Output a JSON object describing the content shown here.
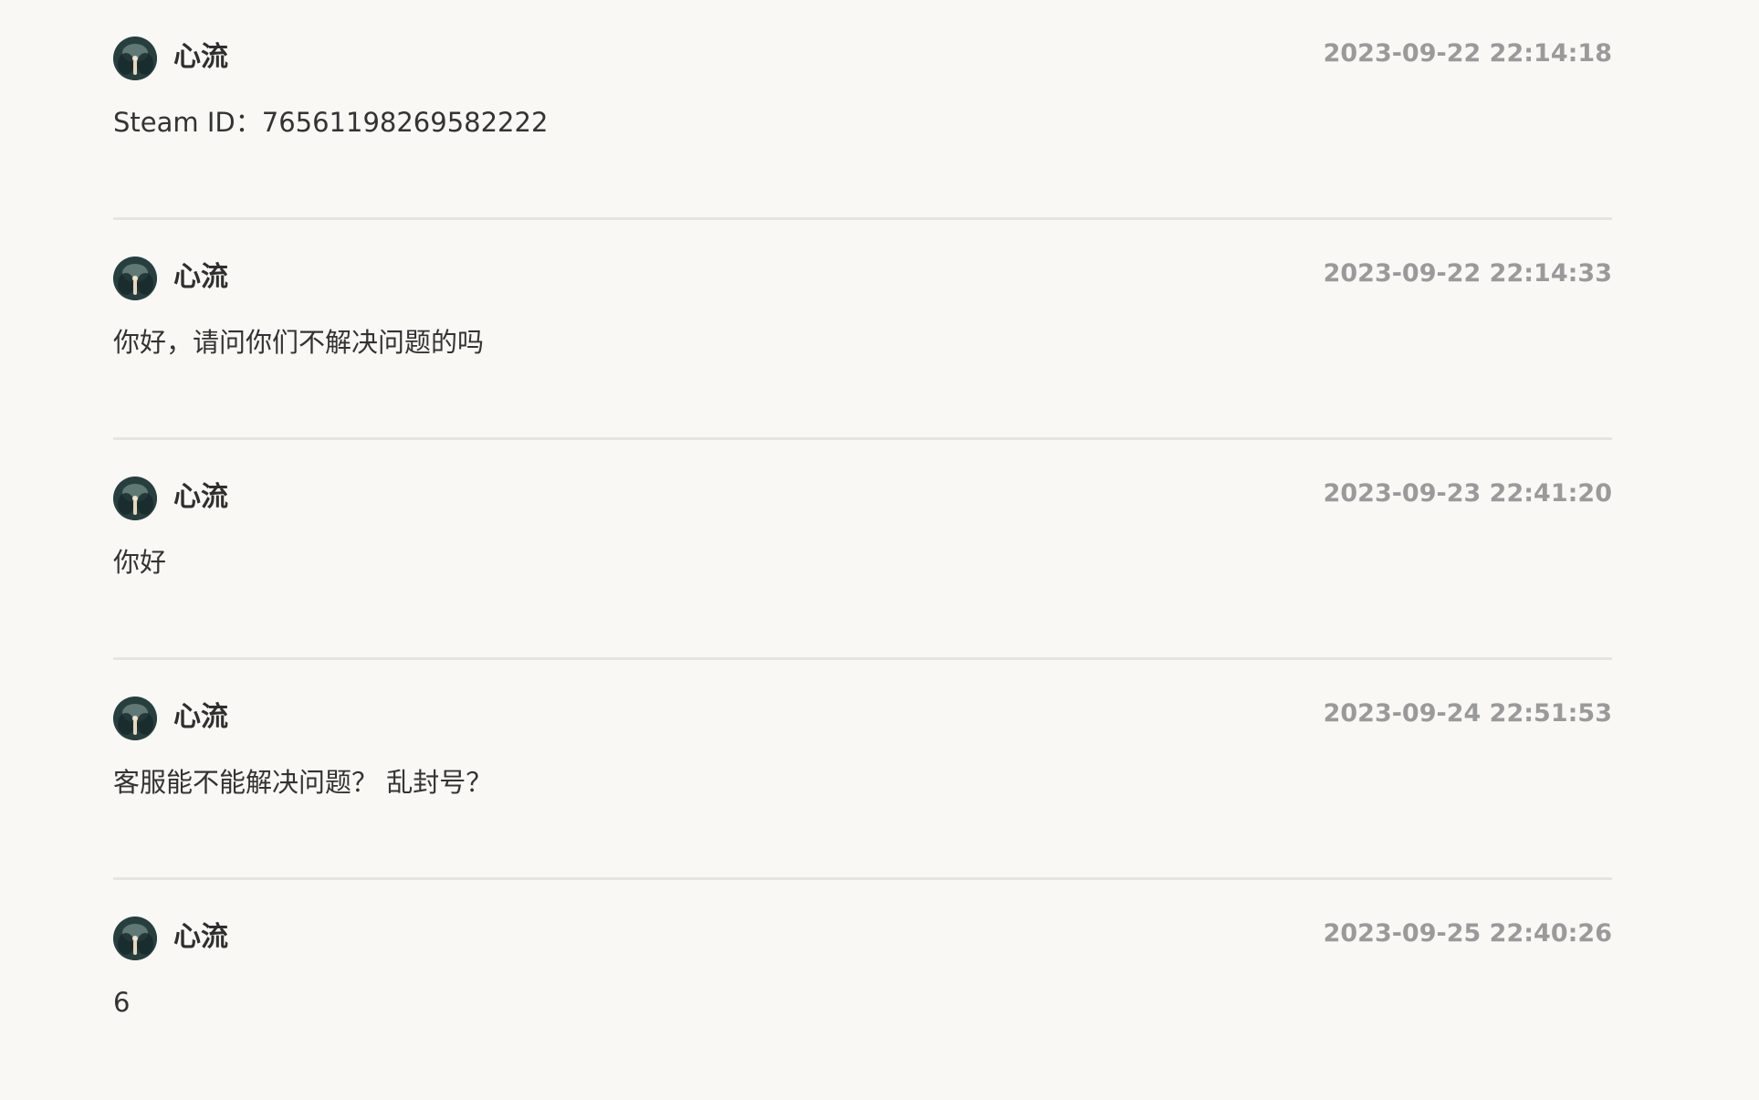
{
  "messages": [
    {
      "author": "心流",
      "timestamp": "2023-09-22 22:14:18",
      "text": "Steam ID：76561198269582222"
    },
    {
      "author": "心流",
      "timestamp": "2023-09-22 22:14:33",
      "text": "你好，请问你们不解决问题的吗"
    },
    {
      "author": "心流",
      "timestamp": "2023-09-23 22:41:20",
      "text": "你好"
    },
    {
      "author": "心流",
      "timestamp": "2023-09-24 22:51:53",
      "text": "客服能不能解决问题？ 乱封号？"
    },
    {
      "author": "心流",
      "timestamp": "2023-09-25 22:40:26",
      "text": "6"
    }
  ]
}
